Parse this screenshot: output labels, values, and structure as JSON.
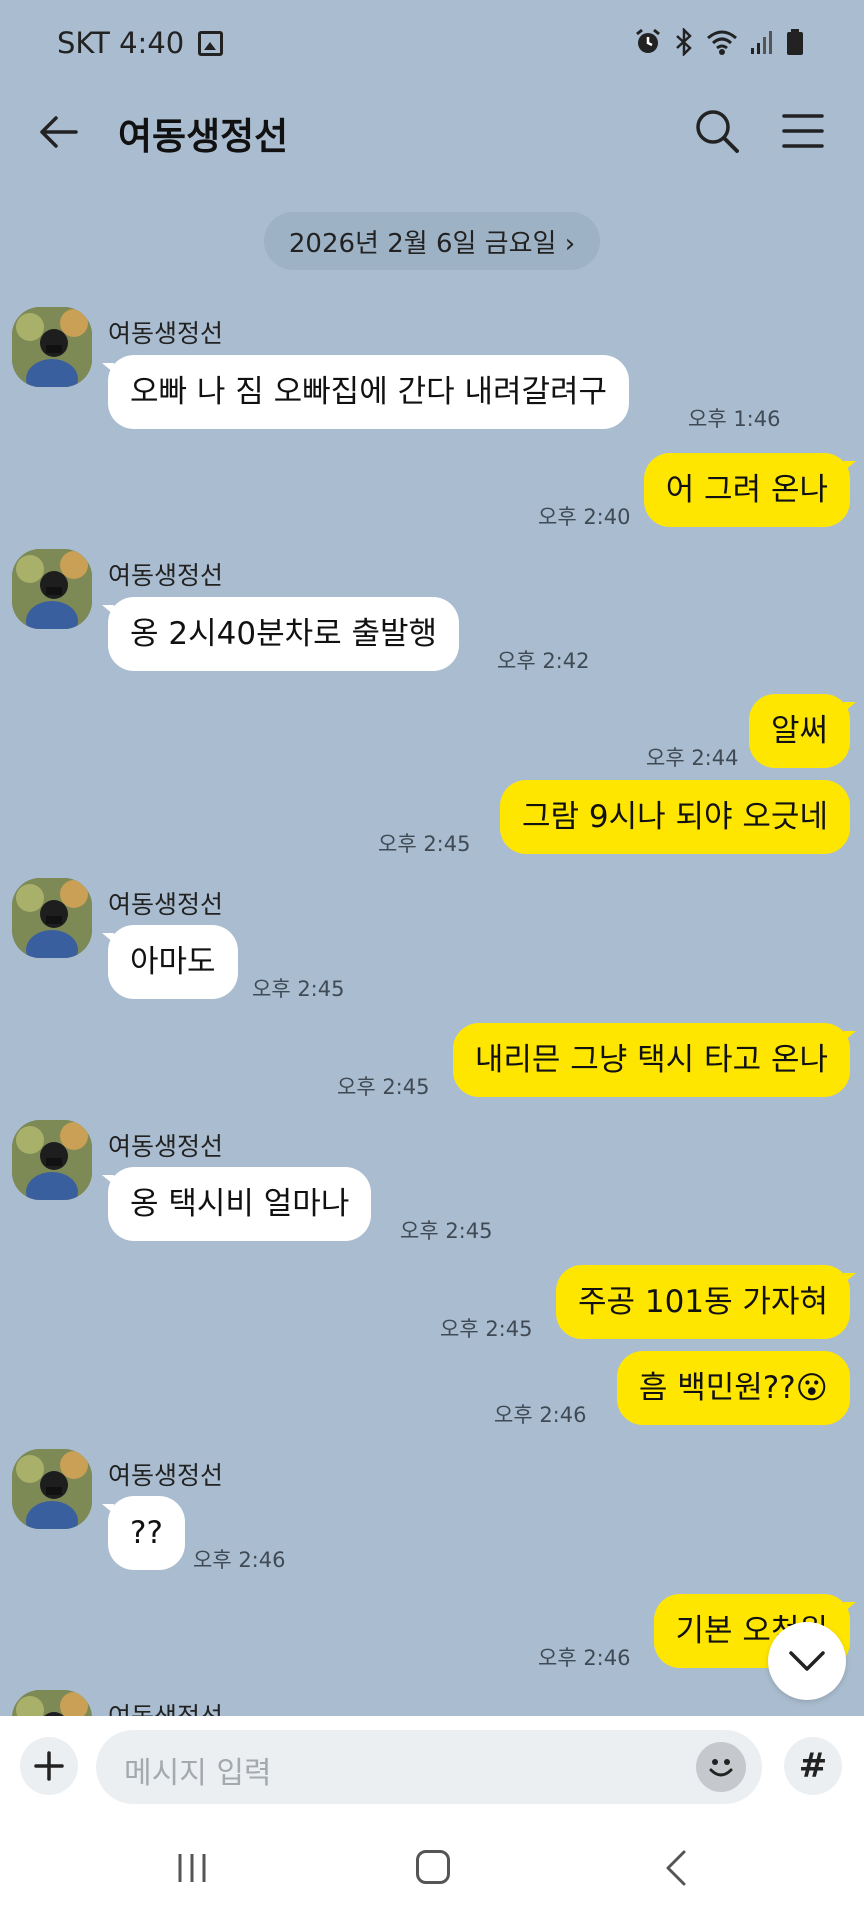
{
  "status": {
    "time": "SKT 4:40"
  },
  "header": {
    "title": "여동생정선"
  },
  "date_chip": "2026년 2월 6일 금요일 ›",
  "messages": [
    {
      "dir": "in",
      "sender": "여동생정선",
      "text": "오빠  나 짐 오빠집에 간다  내려갈려구",
      "time": "오후 1:46"
    },
    {
      "dir": "out",
      "text": "어 그려 온나",
      "time": "오후 2:40"
    },
    {
      "dir": "in",
      "sender": "여동생정선",
      "text": "옹  2시40분차로  출발행",
      "time": "오후 2:42"
    },
    {
      "dir": "out",
      "text": "알써",
      "time": "오후 2:44"
    },
    {
      "dir": "out",
      "text": "그람 9시나 되야  오긋네",
      "time": "오후 2:45"
    },
    {
      "dir": "in",
      "sender": "여동생정선",
      "text": "아마도",
      "time": "오후 2:45"
    },
    {
      "dir": "out",
      "text": "내리믄 그냥 택시 타고 온나",
      "time": "오후 2:45"
    },
    {
      "dir": "in",
      "sender": "여동생정선",
      "text": "옹  택시비 얼마나",
      "time": "오후 2:45"
    },
    {
      "dir": "out",
      "text": "주공 101동  가자혀",
      "time": "오후 2:45"
    },
    {
      "dir": "out",
      "text": "흠  백민원??😮",
      "time": "오후 2:46"
    },
    {
      "dir": "in",
      "sender": "여동생정선",
      "text": "??",
      "time": "오후 2:46"
    },
    {
      "dir": "out",
      "text": "기본  오천원",
      "time": "오후 2:46"
    },
    {
      "dir": "in",
      "sender": "여동생정선"
    }
  ],
  "input": {
    "placeholder": "메시지 입력",
    "hash": "#"
  },
  "colors": {
    "background": "#aabdd0",
    "outgoing_bubble": "#ffe600",
    "incoming_bubble": "#ffffff"
  },
  "icons": [
    "back-arrow-icon",
    "search-icon",
    "menu-icon",
    "plus-icon",
    "emoji-icon",
    "chevron-down-icon"
  ]
}
